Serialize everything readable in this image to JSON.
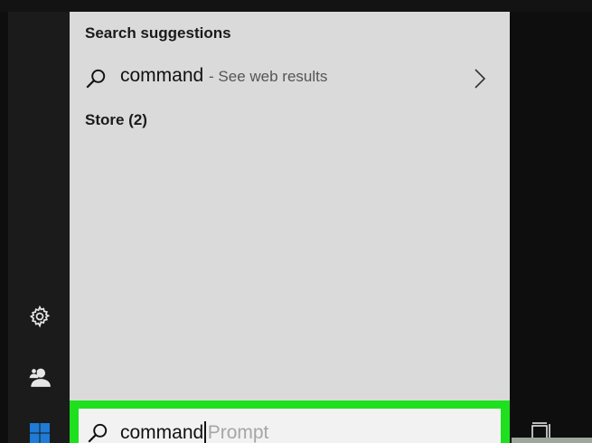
{
  "panel": {
    "suggestions_header": "Search suggestions",
    "suggestion": {
      "query": "command",
      "sub": "- See web results"
    },
    "store_header": "Store (2)"
  },
  "searchbox": {
    "value": "command",
    "placeholder": "Prompt",
    "highlight_color": "#1fe01f"
  },
  "rail": {
    "icons": [
      "gear-icon",
      "user-icon",
      "windows-logo-icon"
    ]
  },
  "taskbar": {
    "icons": [
      "task-view-icon"
    ]
  }
}
